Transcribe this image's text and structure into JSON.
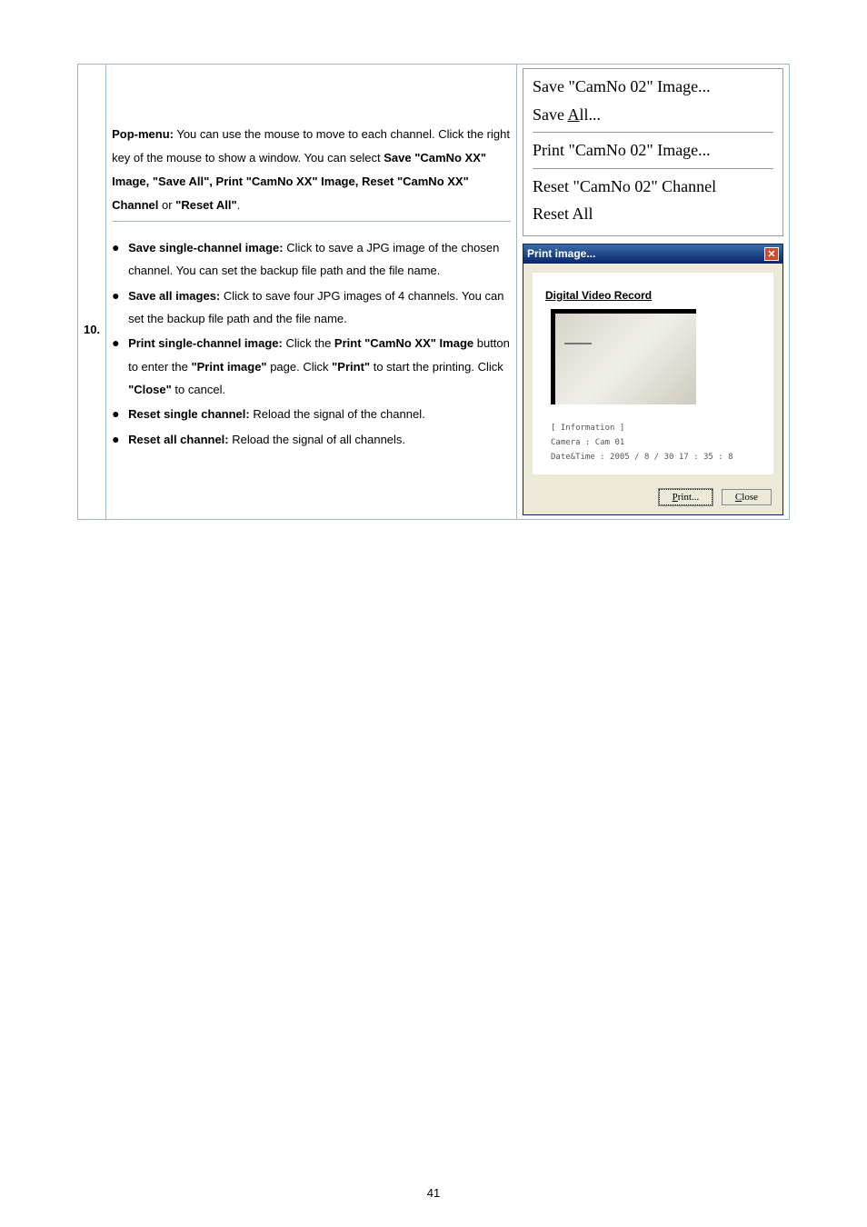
{
  "row_number": "10.",
  "intro": {
    "lead": "Pop-menu:",
    "text1": " You can use the mouse to move to each channel. Click the right key of the mouse to show a window. You can select ",
    "bold1": "Save \"CamNo XX\" Image, \"Save All\", Print \"CamNo XX\" Image, Reset \"CamNo XX\" Channel",
    "text2": " or ",
    "bold2": "\"Reset All\"",
    "text3": "."
  },
  "bullets": [
    {
      "title": "Save single-channel image:",
      "body": " Click to save a JPG image of the chosen channel. You can set the backup file path and the file name."
    },
    {
      "title": "Save all images:",
      "body": " Click to save four JPG images of 4 channels. You can set the backup file path and the file name."
    },
    {
      "title": "Print single-channel image:",
      "body_parts": [
        {
          "t": " Click the ",
          "b": false
        },
        {
          "t": "Print \"CamNo XX\" Image",
          "b": true
        },
        {
          "t": " button to enter the ",
          "b": false
        },
        {
          "t": "\"Print image\"",
          "b": true
        },
        {
          "t": " page. Click ",
          "b": false
        },
        {
          "t": "\"Print\"",
          "b": true
        },
        {
          "t": " to start the printing. Click ",
          "b": false
        },
        {
          "t": "\"Close\"",
          "b": true
        },
        {
          "t": " to cancel.",
          "b": false
        }
      ]
    },
    {
      "title": "Reset single channel:",
      "body": " Reload the signal of the channel."
    },
    {
      "title": "Reset all channel:",
      "body": " Reload the signal of all channels."
    }
  ],
  "context_menu": {
    "item1": "Save \"CamNo 02\" Image...",
    "item2_pre": "Save ",
    "item2_u": "A",
    "item2_post": "ll...",
    "item3": "Print \"CamNo 02\" Image...",
    "item4": "Reset \"CamNo 02\" Channel",
    "item5": "Reset All"
  },
  "dialog": {
    "title": "Print image...",
    "dvr_title": "Digital Video Record",
    "info_header": "[ Information ]",
    "info_camera": "Camera    : Cam 01",
    "info_datetime": "Date&Time : 2005 / 8 / 30  17 : 35 : 8",
    "print_u": "P",
    "print_rest": "rint...",
    "close_u": "C",
    "close_rest": "lose"
  },
  "page_number": "41"
}
